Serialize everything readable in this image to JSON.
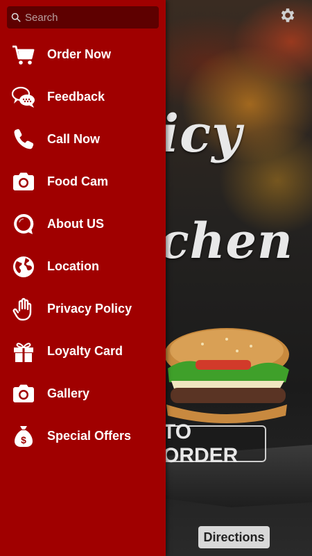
{
  "search": {
    "placeholder": "Search"
  },
  "menu": {
    "items": [
      {
        "label": "Order Now",
        "icon": "cart-icon"
      },
      {
        "label": "Feedback",
        "icon": "chat-bubbles-icon"
      },
      {
        "label": "Call Now",
        "icon": "phone-icon"
      },
      {
        "label": "Food Cam",
        "icon": "camera-icon"
      },
      {
        "label": "About US",
        "icon": "info-bubble-icon"
      },
      {
        "label": "Location",
        "icon": "globe-icon"
      },
      {
        "label": "Privacy Policy",
        "icon": "hand-icon"
      },
      {
        "label": "Loyalty Card",
        "icon": "gift-icon"
      },
      {
        "label": "Gallery",
        "icon": "camera-icon"
      },
      {
        "label": "Special Offers",
        "icon": "money-bag-icon"
      }
    ]
  },
  "background": {
    "script_line_1": "icy",
    "script_line_2": "chen",
    "order_button": "TO ORDER",
    "directions_button": "Directions"
  },
  "colors": {
    "drawer": "#a00000",
    "search_bg": "#5e0000"
  }
}
